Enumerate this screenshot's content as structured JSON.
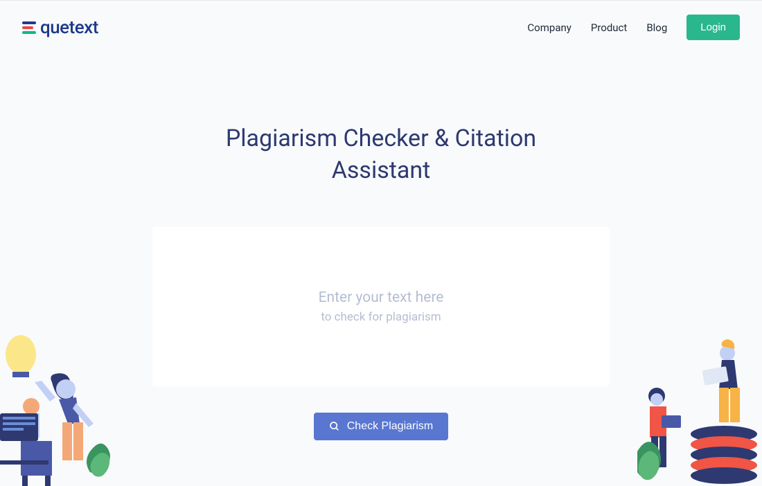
{
  "brand": {
    "name": "quetext"
  },
  "nav": {
    "company": "Company",
    "product": "Product",
    "blog": "Blog",
    "login": "Login"
  },
  "hero": {
    "title": "Plagiarism Checker & Citation Assistant",
    "placeholder_main": "Enter your text here",
    "placeholder_sub": "to check for plagiarism",
    "cta_label": "Check Plagiarism"
  }
}
